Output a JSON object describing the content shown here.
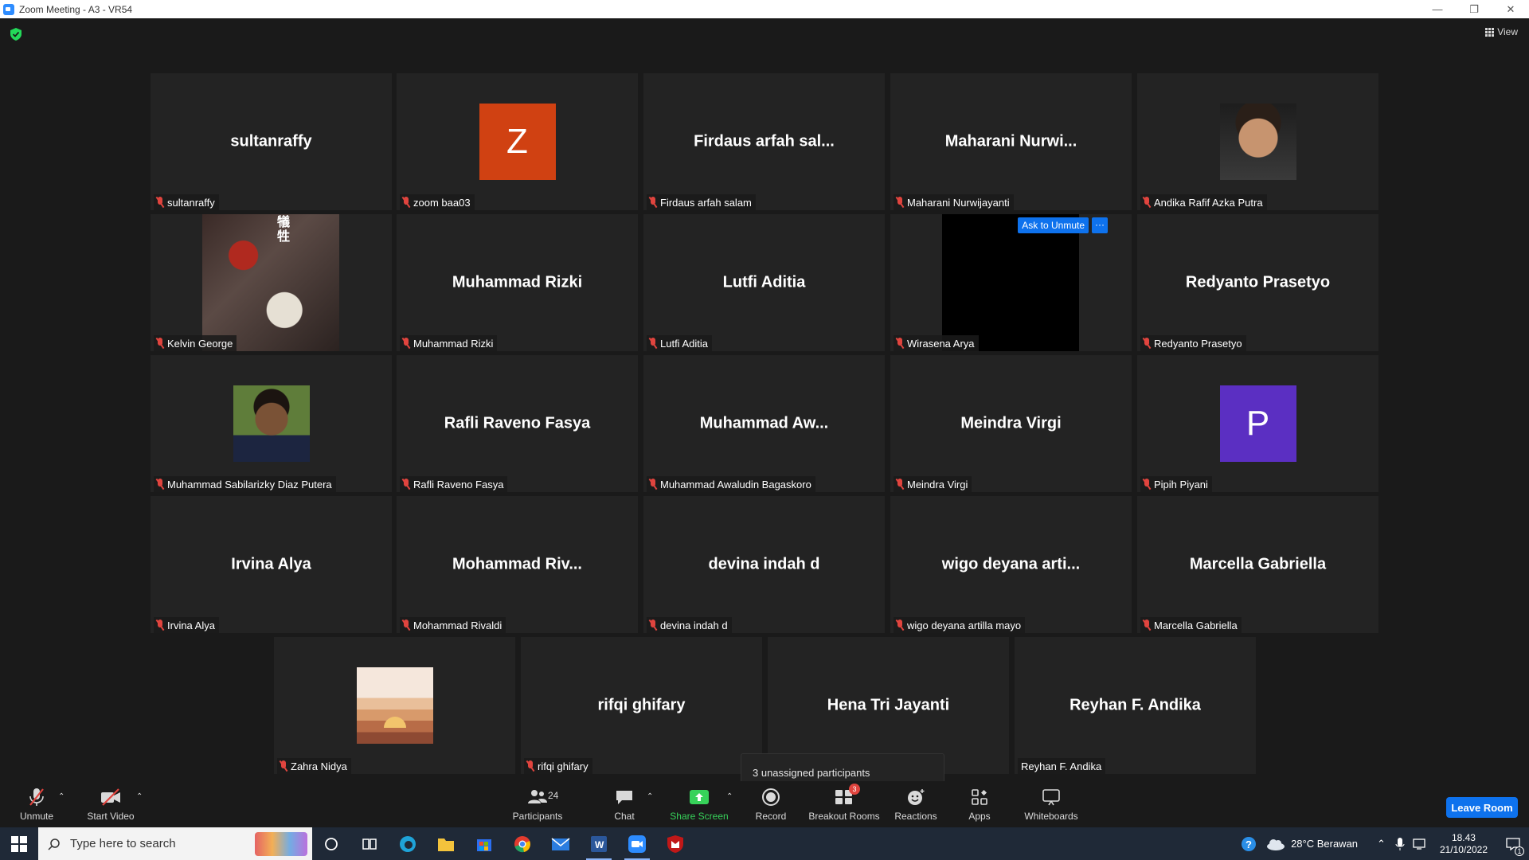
{
  "window": {
    "title": "Zoom Meeting - A3 - VR54"
  },
  "view_label": "View",
  "tiles": [
    {
      "big": "sultanraffy",
      "label": "sultanraffy"
    },
    {
      "letter": "Z",
      "color": "#d04112",
      "label": "zoom baa03"
    },
    {
      "big": "Firdaus arfah sal...",
      "label": "Firdaus arfah salam"
    },
    {
      "big": "Maharani  Nurwi...",
      "label": "Maharani Nurwijayanti"
    },
    {
      "label": "Andika Rafif Azka Putra"
    },
    {
      "label": "Kelvin George",
      "kanji": "犠\n牲"
    },
    {
      "big": "Muhammad Rizki",
      "label": "Muhammad Rizki"
    },
    {
      "big": "Lutfi Aditia",
      "label": "Lutfi Aditia"
    },
    {
      "label": "Wirasena Arya",
      "ask": "Ask to Unmute",
      "more": "···"
    },
    {
      "big": "Redyanto Prasetyo",
      "label": "Redyanto Prasetyo"
    },
    {
      "label": "Muhammad Sabilarizky Diaz Putera"
    },
    {
      "big": "Rafli Raveno Fasya",
      "label": "Rafli Raveno Fasya"
    },
    {
      "big": "Muhammad  Aw...",
      "label": "Muhammad Awaludin Bagaskoro"
    },
    {
      "big": "Meindra Virgi",
      "label": "Meindra Virgi"
    },
    {
      "letter": "P",
      "color": "#5b2fc2",
      "label": "Pipih Piyani"
    },
    {
      "big": "Irvina Alya",
      "label": "Irvina Alya"
    },
    {
      "big": "Mohammad  Riv...",
      "label": "Mohammad Rivaldi"
    },
    {
      "big": "devina indah d",
      "label": "devina indah d"
    },
    {
      "big": "wigo deyana arti...",
      "label": "wigo deyana artilla mayo"
    },
    {
      "big": "Marcella Gabriella",
      "label": "Marcella Gabriella"
    },
    {
      "label": "Zahra Nidya"
    },
    {
      "big": "rifqi ghifary",
      "label": "rifqi ghifary"
    },
    {
      "big": "Hena Tri Jayanti",
      "label": "Hena Tri Jayanti"
    },
    {
      "big": "Reyhan F. Andika",
      "label": "Reyhan F. Andika"
    }
  ],
  "tooltip": "3 unassigned participants",
  "toolbar": {
    "unmute": "Unmute",
    "start_video": "Start Video",
    "participants": "Participants",
    "participants_count": "24",
    "chat": "Chat",
    "share_screen": "Share Screen",
    "record": "Record",
    "breakout_rooms": "Breakout Rooms",
    "breakout_badge": "3",
    "reactions": "Reactions",
    "apps": "Apps",
    "whiteboards": "Whiteboards",
    "leave": "Leave Room"
  },
  "taskbar": {
    "search_placeholder": "Type here to search",
    "weather": "28°C  Berawan",
    "time": "18.43",
    "date": "21/10/2022",
    "notif_count": "1"
  },
  "colors": {
    "accent": "#0e72ed",
    "muted_red": "#e0443e",
    "share_green": "#37d25a"
  }
}
